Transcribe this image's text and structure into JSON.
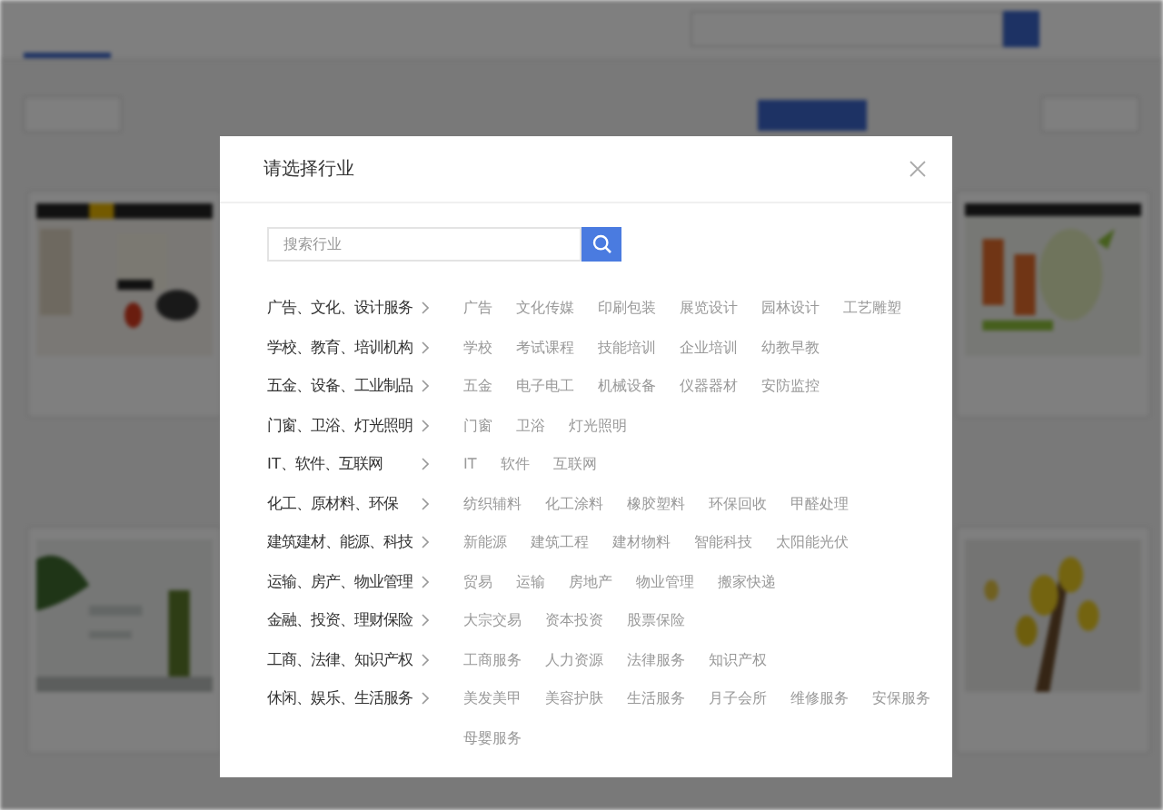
{
  "dialog": {
    "title": "请选择行业",
    "search": {
      "placeholder": "搜索行业"
    },
    "categories": [
      {
        "name": "广告、文化、设计服务",
        "items": [
          "广告",
          "文化传媒",
          "印刷包装",
          "展览设计",
          "园林设计",
          "工艺雕塑"
        ]
      },
      {
        "name": "学校、教育、培训机构",
        "items": [
          "学校",
          "考试课程",
          "技能培训",
          "企业培训",
          "幼教早教"
        ]
      },
      {
        "name": "五金、设备、工业制品",
        "items": [
          "五金",
          "电子电工",
          "机械设备",
          "仪器器材",
          "安防监控"
        ]
      },
      {
        "name": "门窗、卫浴、灯光照明",
        "items": [
          "门窗",
          "卫浴",
          "灯光照明"
        ]
      },
      {
        "name": "IT、软件、互联网",
        "items": [
          "IT",
          "软件",
          "互联网"
        ]
      },
      {
        "name": "化工、原材料、环保",
        "items": [
          "纺织辅料",
          "化工涂料",
          "橡胶塑料",
          "环保回收",
          "甲醛处理"
        ]
      },
      {
        "name": "建筑建材、能源、科技",
        "items": [
          "新能源",
          "建筑工程",
          "建材物料",
          "智能科技",
          "太阳能光伏"
        ]
      },
      {
        "name": "运输、房产、物业管理",
        "items": [
          "贸易",
          "运输",
          "房地产",
          "物业管理",
          "搬家快递"
        ]
      },
      {
        "name": "金融、投资、理财保险",
        "items": [
          "大宗交易",
          "资本投资",
          "股票保险"
        ]
      },
      {
        "name": "工商、法律、知识产权",
        "items": [
          "工商服务",
          "人力资源",
          "法律服务",
          "知识产权"
        ]
      },
      {
        "name": "休闲、娱乐、生活服务",
        "items": [
          "美发美甲",
          "美容护肤",
          "生活服务",
          "月子会所",
          "维修服务",
          "安保服务",
          "母婴服务"
        ]
      }
    ]
  }
}
